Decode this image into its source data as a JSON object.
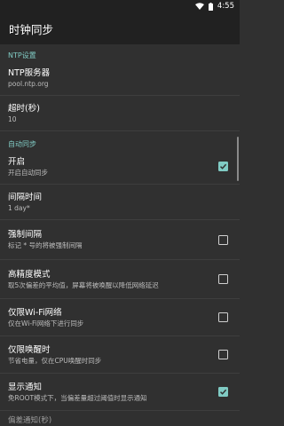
{
  "status_bar": {
    "time": "4:55"
  },
  "app_bar": {
    "title": "时钟同步"
  },
  "sections": {
    "ntp": {
      "header": "NTP设置"
    },
    "auto": {
      "header": "自动同步"
    }
  },
  "prefs": {
    "ntp_server": {
      "title": "NTP服务器",
      "summary": "pool.ntp.org"
    },
    "timeout": {
      "title": "超时(秒)",
      "summary": "10"
    },
    "enable": {
      "title": "开启",
      "summary": "开启自动同步",
      "checked": true
    },
    "interval": {
      "title": "间隔时间",
      "summary": "1 day*"
    },
    "force_interval": {
      "title": "强制间隔",
      "summary": "标记 * 号的将被强制间隔",
      "checked": false
    },
    "high_precision": {
      "title": "高精度模式",
      "summary": "取5次偏差的平均值，屏幕将被唤醒以降低网络延迟",
      "checked": false
    },
    "wifi_only": {
      "title": "仅限Wi-Fi网络",
      "summary": "仅在Wi-Fi网络下进行同步",
      "checked": false
    },
    "wake_only": {
      "title": "仅限唤醒时",
      "summary": "节省电量，仅在CPU唤醒时同步",
      "checked": false
    },
    "notify": {
      "title": "显示通知",
      "summary": "免ROOT模式下，当偏差量超过阈值时显示通知",
      "checked": true
    },
    "partial_next": {
      "title": "偏差通知(秒)"
    }
  },
  "colors": {
    "accent": "#80cbc4",
    "background": "#303030",
    "bar": "#212121"
  }
}
